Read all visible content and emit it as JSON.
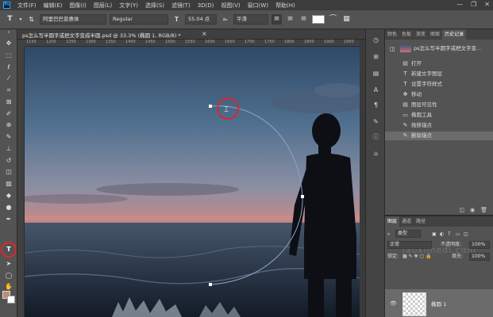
{
  "menubar": {
    "logo": "Ps",
    "items": [
      "文件(F)",
      "编辑(E)",
      "图像(I)",
      "图层(L)",
      "文字(Y)",
      "选择(S)",
      "滤镜(T)",
      "3D(D)",
      "视图(V)",
      "窗口(W)",
      "帮助(H)"
    ],
    "window_buttons": [
      "—",
      "❐",
      "✕"
    ]
  },
  "options": {
    "tool_glyph": "T",
    "font_family": "阿里巴巴普惠体",
    "font_style": "Regular",
    "font_size": "55.04 点",
    "antialias": "平滑",
    "color_swatch": "#ffffff"
  },
  "document": {
    "tab_title": "ps怎么写半圆字或把文字变成半圆.psd @ 33.3% (椭圆 1, RGB/8) *",
    "close": "×",
    "ruler_ticks": [
      "1150",
      "1200",
      "1250",
      "1300",
      "1350",
      "1400",
      "1450",
      "1500",
      "1550",
      "1600",
      "1650",
      "1700",
      "1750",
      "1800",
      "1850",
      "1900",
      "1950"
    ]
  },
  "history": {
    "tabs": [
      "颜色",
      "色板",
      "渐变",
      "图案",
      "历史记录"
    ],
    "active_tab": "历史记录",
    "snapshot_label": "ps怎么写半圆字或把文字变...",
    "items": [
      {
        "icon": "open-icon",
        "glyph": "▤",
        "label": "打开"
      },
      {
        "icon": "type-icon",
        "glyph": "T",
        "label": "新建文字图层"
      },
      {
        "icon": "type-icon",
        "glyph": "T",
        "label": "设置字符样式"
      },
      {
        "icon": "move-icon",
        "glyph": "✥",
        "label": "移动"
      },
      {
        "icon": "layer-visibility-icon",
        "glyph": "▤",
        "label": "图层可见性"
      },
      {
        "icon": "ellipse-icon",
        "glyph": "▭",
        "label": "椭圆工具"
      },
      {
        "icon": "pen-icon",
        "glyph": "✎",
        "label": "拖移锚点"
      },
      {
        "icon": "pen-icon",
        "glyph": "✎",
        "label": "删除锚点"
      }
    ],
    "selected_index": 7
  },
  "layers": {
    "tabs": [
      "图层",
      "通道",
      "路径"
    ],
    "kind_label": "类型",
    "blend_mode": "正常",
    "opacity_label": "不透明度:",
    "opacity": "100%",
    "lock_label": "锁定:",
    "fill_label": "填充:",
    "fill": "100%",
    "layer_name": "椭圆 1",
    "watermark": "jaoximedi.com"
  },
  "colors": {
    "accent_ring": "#d9272e",
    "path_stroke": "#8aa3c8"
  }
}
